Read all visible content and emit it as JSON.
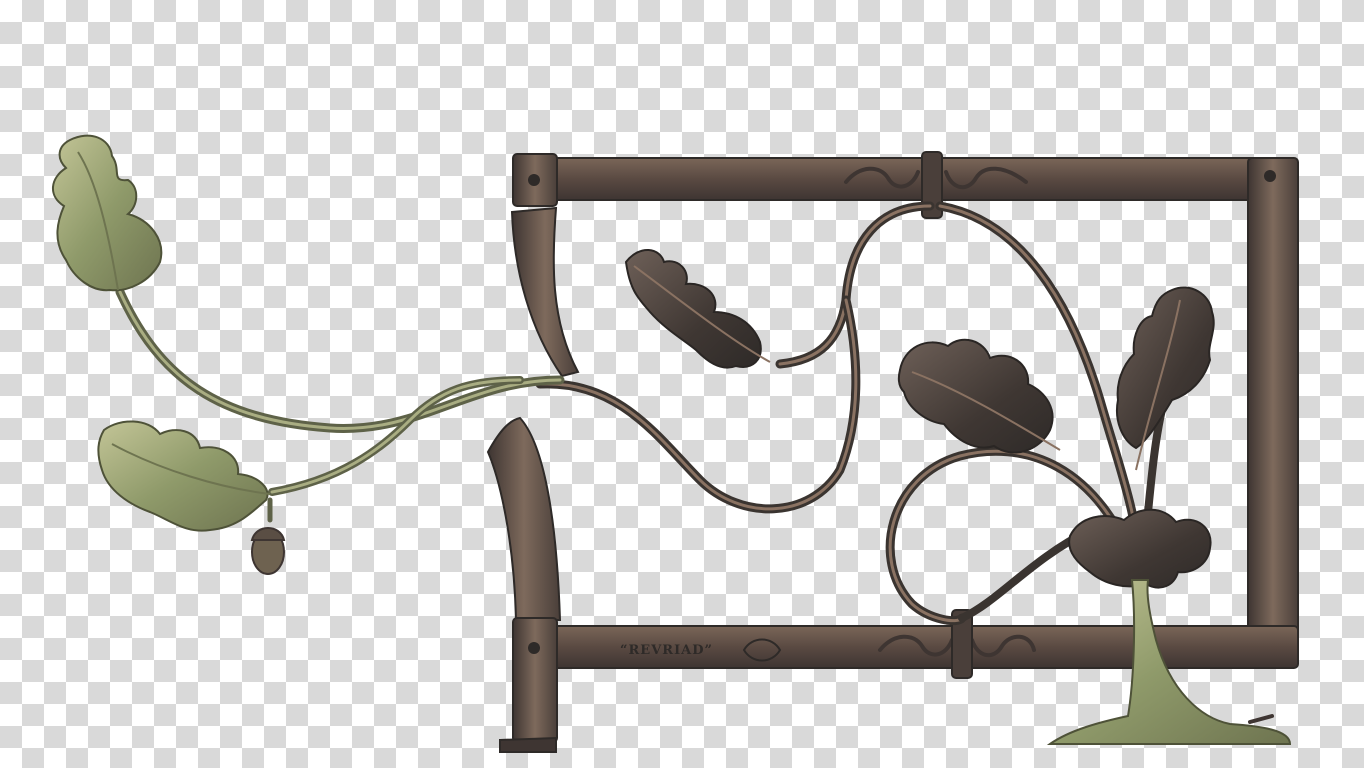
{
  "image": {
    "stamp_text": "“REVRIAD”",
    "colors": {
      "checker_light": "#ffffff",
      "checker_dark": "#d9d9d9",
      "iron_dark": "#3a3430",
      "iron_mid": "#6b5a50",
      "iron_highlight": "#9a7e6a",
      "patina_green": "#8c9a6a",
      "patina_light": "#b8bd8e"
    }
  }
}
